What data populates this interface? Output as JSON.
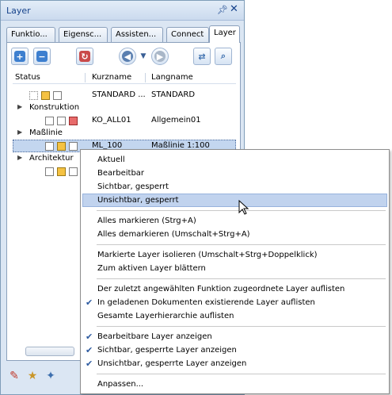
{
  "window": {
    "title": "Layer",
    "pin_icon": "pin-icon",
    "close_glyph": "✕"
  },
  "tabs": [
    {
      "label": "Funktio..."
    },
    {
      "label": "Eigensc..."
    },
    {
      "label": "Assisten..."
    },
    {
      "label": "Connect"
    },
    {
      "label": "Layer",
      "active": true
    }
  ],
  "toolbar": {
    "buttons": [
      "add-layer-icon",
      "remove-layer-icon",
      "refresh-icon",
      "back-icon",
      "dropdown-arrow-icon",
      "forward-icon",
      "swap-icon",
      "search-icon"
    ]
  },
  "columns": {
    "status": "Status",
    "kurzname": "Kurzname",
    "langname": "Langname"
  },
  "rows": [
    {
      "kurzname": "STANDARD ...",
      "langname": "STANDARD"
    },
    {
      "group": "Konstruktion"
    },
    {
      "kurzname": "KO_ALL01",
      "langname": "Allgemein01"
    },
    {
      "group": "Maßlinie"
    },
    {
      "kurzname": "ML_100",
      "langname": "Maßlinie 1:100"
    },
    {
      "group": "Architektur"
    }
  ],
  "colors": {
    "accent": "#c1d3ee",
    "selected_row": "#c3d6ef",
    "status_yellow": "#f5c242",
    "status_red": "#e86b6b",
    "check": "#2c5aa0"
  },
  "menu": {
    "items": [
      {
        "label": "Aktuell"
      },
      {
        "label": "Bearbeitbar"
      },
      {
        "label": "Sichtbar, gesperrt"
      },
      {
        "label": "Unsichtbar, gesperrt",
        "highlighted": true
      },
      {
        "label": "Alles markieren (Strg+A)"
      },
      {
        "label": "Alles demarkieren (Umschalt+Strg+A)"
      },
      {
        "label": "Markierte Layer isolieren (Umschalt+Strg+Doppelklick)"
      },
      {
        "label": "Zum aktiven Layer blättern"
      },
      {
        "label": "Der zuletzt angewählten Funktion zugeordnete Layer auflisten"
      },
      {
        "label": "In geladenen Dokumenten existierende Layer auflisten",
        "checked": true
      },
      {
        "label": "Gesamte Layerhierarchie auflisten"
      },
      {
        "label": "Bearbeitbare Layer anzeigen",
        "checked": true
      },
      {
        "label": "Sichtbar, gesperrte Layer anzeigen",
        "checked": true
      },
      {
        "label": "Unsichtbar, gesperrte Layer anzeigen",
        "checked": true
      },
      {
        "label": "Anpassen..."
      }
    ],
    "check_glyph": "✔"
  },
  "bottom_icons": [
    "layer-pen-icon",
    "folder-star-icon",
    "star-settings-icon"
  ]
}
